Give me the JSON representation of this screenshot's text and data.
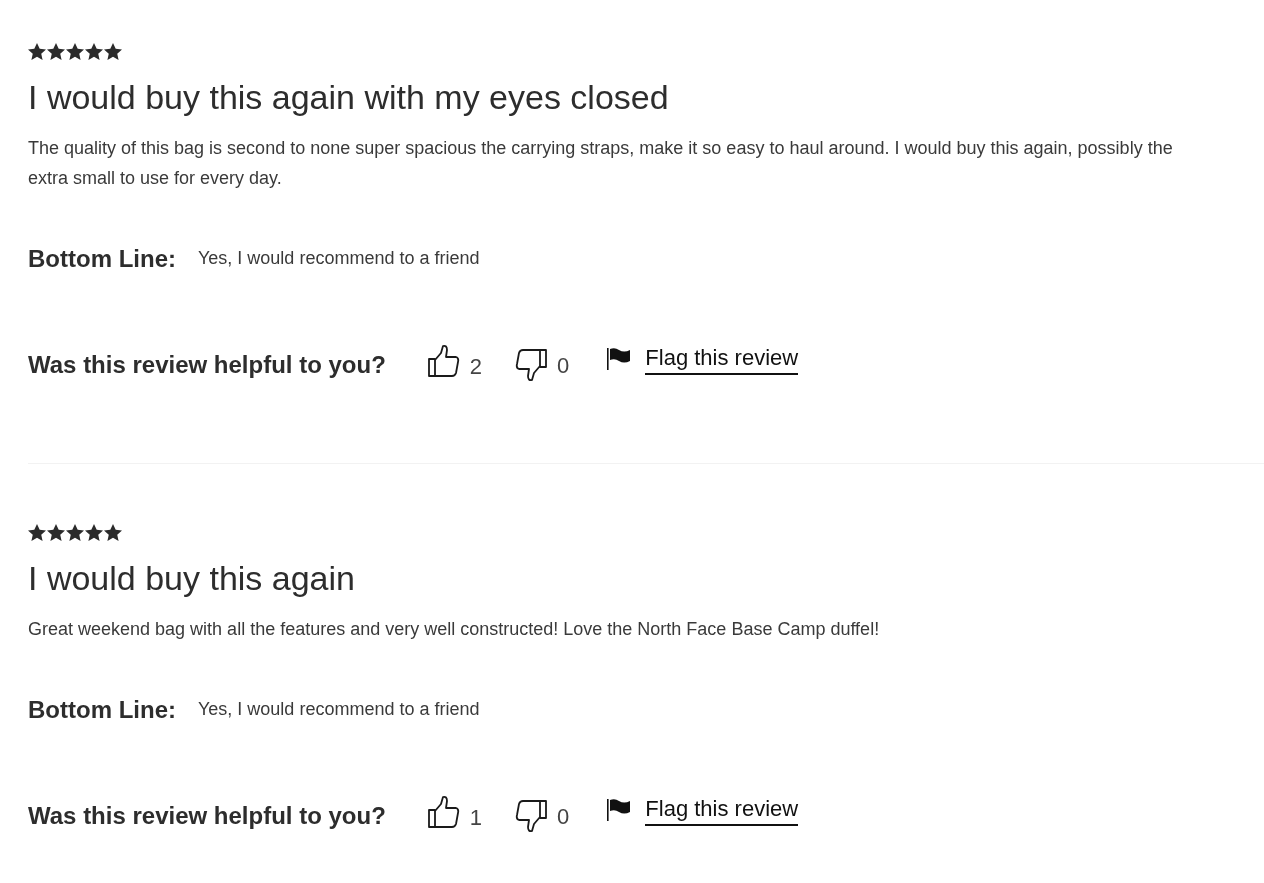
{
  "reviews": [
    {
      "stars": 5,
      "title": "I would buy this again with my eyes closed",
      "body": "The quality of this bag is second to none super spacious the carrying straps, make it so easy to haul around. I would buy this again, possibly the extra small to use for every day.",
      "bottom_line": {
        "label": "Bottom Line:",
        "value": "Yes, I would recommend to a friend"
      },
      "helpful": {
        "question": "Was this review helpful to you?",
        "upvotes": "2",
        "downvotes": "0",
        "flag_link": "Flag this review"
      }
    },
    {
      "stars": 5,
      "title": "I would buy this again",
      "body": "Great weekend bag with all the features and very well constructed! Love the North Face Base Camp duffel!",
      "bottom_line": {
        "label": "Bottom Line:",
        "value": "Yes, I would recommend to a friend"
      },
      "helpful": {
        "question": "Was this review helpful to you?",
        "upvotes": "1",
        "downvotes": "0",
        "flag_link": "Flag this review"
      }
    }
  ]
}
